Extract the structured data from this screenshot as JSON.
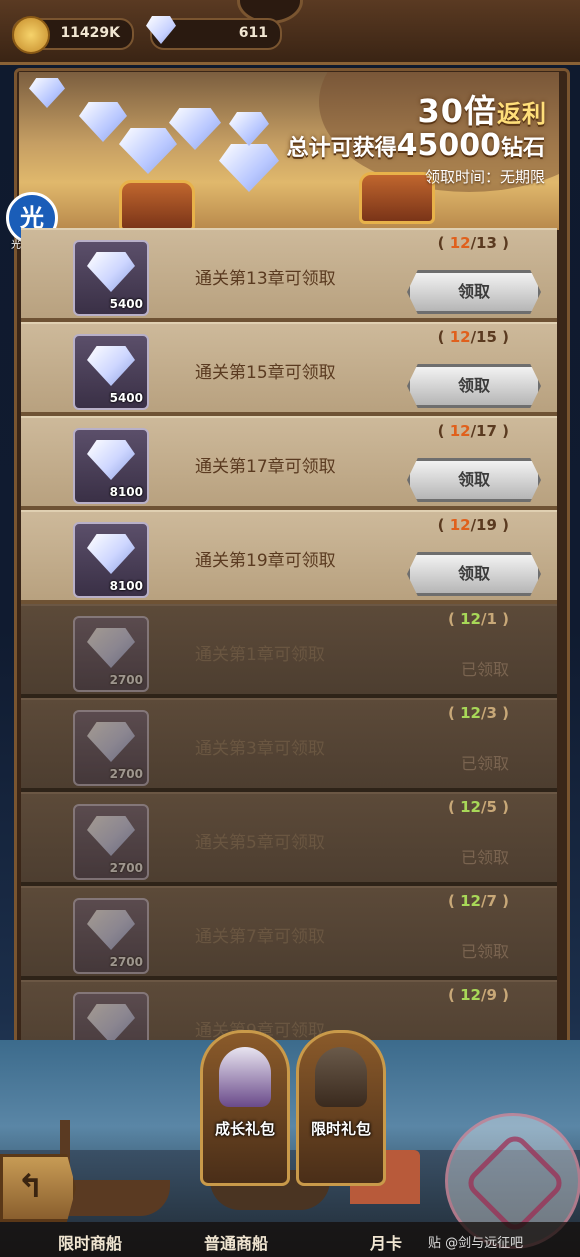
{
  "topbar": {
    "gold_value": "11429K",
    "diamond_value": "611"
  },
  "banner": {
    "multiplier": "30倍",
    "multiplier_suffix": "返利",
    "total_prefix": "总计可获得",
    "total_amount": "45000",
    "total_suffix": "钻石",
    "claim_time": "领取时间：无期限"
  },
  "badge": {
    "glyph": "光",
    "label": "光环助手"
  },
  "rewards": [
    {
      "amount": "5400",
      "title": "通关第13章可领取",
      "current": "12",
      "target": "/13",
      "status": "claimable",
      "button": "领取"
    },
    {
      "amount": "5400",
      "title": "通关第15章可领取",
      "current": "12",
      "target": "/15",
      "status": "claimable",
      "button": "领取"
    },
    {
      "amount": "8100",
      "title": "通关第17章可领取",
      "current": "12",
      "target": "/17",
      "status": "claimable",
      "button": "领取"
    },
    {
      "amount": "8100",
      "title": "通关第19章可领取",
      "current": "12",
      "target": "/19",
      "status": "claimable",
      "button": "领取"
    },
    {
      "amount": "2700",
      "title": "通关第1章可领取",
      "current": "12",
      "target": "/1",
      "status": "claimed",
      "claimed_text": "已领取"
    },
    {
      "amount": "2700",
      "title": "通关第3章可领取",
      "current": "12",
      "target": "/3",
      "status": "claimed",
      "claimed_text": "已领取"
    },
    {
      "amount": "2700",
      "title": "通关第5章可领取",
      "current": "12",
      "target": "/5",
      "status": "claimed",
      "claimed_text": "已领取"
    },
    {
      "amount": "2700",
      "title": "通关第7章可领取",
      "current": "12",
      "target": "/7",
      "status": "claimed",
      "claimed_text": "已领取"
    },
    {
      "amount": "",
      "title": "通关第9章可领取",
      "current": "12",
      "target": "/9",
      "status": "claimed",
      "claimed_text": ""
    }
  ],
  "packs": {
    "growth": "成长礼包",
    "limited": "限时礼包"
  },
  "tabs": {
    "limited_ship": "限时商船",
    "normal_ship": "普通商船",
    "monthly_card": "月卡"
  },
  "watermark": {
    "tieba": "贴 @剑与远征吧"
  },
  "colors": {
    "progress_current_active": "#e0601c",
    "progress_current_done": "#a8d858",
    "row_active": "#c4ad8c",
    "row_done": "#554434"
  }
}
